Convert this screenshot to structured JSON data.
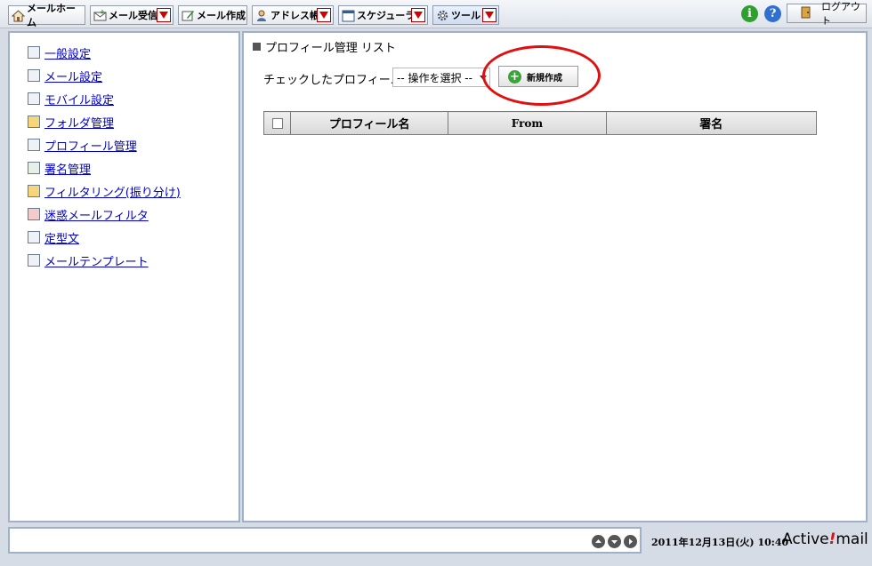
{
  "toolbar": {
    "tabs": [
      {
        "label": "メールホーム",
        "icon": "home-icon"
      },
      {
        "label": "メール受信",
        "icon": "mail-receive-icon"
      },
      {
        "label": "メール作成",
        "icon": "mail-compose-icon"
      },
      {
        "label": "アドレス帳",
        "icon": "address-book-icon"
      },
      {
        "label": "スケジューラ",
        "icon": "scheduler-icon"
      },
      {
        "label": "ツール",
        "icon": "gear-icon"
      }
    ],
    "info_glyph": "i",
    "help_glyph": "?",
    "logout_label": "ログアウト"
  },
  "sidebar": {
    "items": [
      {
        "label": "一般設定",
        "icon": "user-icon"
      },
      {
        "label": "メール設定",
        "icon": "mail-settings-icon"
      },
      {
        "label": "モバイル設定",
        "icon": "mobile-icon"
      },
      {
        "label": "フォルダ管理",
        "icon": "folder-icon"
      },
      {
        "label": "プロフィール管理",
        "icon": "profile-icon"
      },
      {
        "label": "署名管理",
        "icon": "signature-icon"
      },
      {
        "label": "フィルタリング(振り分け)",
        "icon": "filter-icon"
      },
      {
        "label": "迷惑メールフィルタ",
        "icon": "spam-filter-icon"
      },
      {
        "label": "定型文",
        "icon": "template-text-icon"
      },
      {
        "label": "メールテンプレート",
        "icon": "mail-template-icon"
      }
    ]
  },
  "main": {
    "title": "プロフィール管理 リスト",
    "check_label": "チェックしたプロフィールを",
    "action_select": "-- 操作を選択 --",
    "new_button": "新規作成",
    "table": {
      "columns": [
        "プロフィール名",
        "From",
        "署名"
      ]
    }
  },
  "footer": {
    "datetime": "2011年12月13日(火) 10:40",
    "brand_prefix": "Active",
    "brand_mark": "!",
    "brand_suffix": "mail"
  },
  "colors": {
    "link": "#0000cc",
    "highlight_circle": "#e01010",
    "panel_border": "#9fb1c8"
  }
}
